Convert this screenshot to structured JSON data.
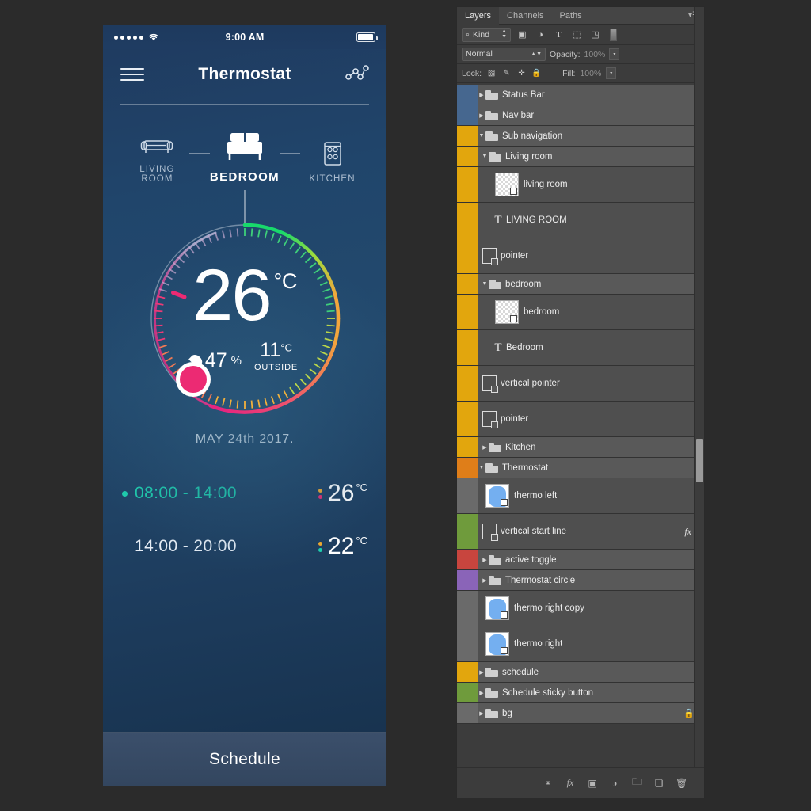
{
  "phone": {
    "status_bar": {
      "signal_dots": 5,
      "wifi_icon": "wifi-icon",
      "time": "9:00 AM",
      "battery_icon": "battery-icon"
    },
    "nav": {
      "menu_icon": "hamburger-icon",
      "title": "Thermostat",
      "graph_icon": "graph-nodes-icon"
    },
    "rooms": [
      {
        "label": "LIVING ROOM",
        "icon": "sofa-icon",
        "active": false
      },
      {
        "label": "BEDROOM",
        "icon": "bed-icon",
        "active": true
      },
      {
        "label": "KITCHEN",
        "icon": "stove-icon",
        "active": false
      }
    ],
    "dial": {
      "temperature": "26",
      "unit": "°C",
      "humidity_value": "47",
      "humidity_unit": "%",
      "humidity_icon": "water-drop-icon",
      "outside_value": "11",
      "outside_unit": "°C",
      "outside_label": "OUTSIDE",
      "handle_color": "#ec2a73",
      "arc_start_color": "#18d96b",
      "arc_mid_color": "#f2b63c",
      "arc_end_color": "#e6257f"
    },
    "date": "MAY 24th 2017.",
    "schedule": [
      {
        "time": "08:00 - 14:00",
        "temp": "26",
        "unit": "°C",
        "active": true,
        "bullet_color": "#1ecfae",
        "time_color": "#1ecfae"
      },
      {
        "time": "14:00 - 20:00",
        "temp": "22",
        "unit": "°C",
        "active": false,
        "bullet_color": "#f0a92e",
        "time_color": "#e7eef6"
      }
    ],
    "schedule_button": "Schedule"
  },
  "photoshop": {
    "tabs": [
      {
        "label": "Layers",
        "active": true
      },
      {
        "label": "Channels",
        "active": false
      },
      {
        "label": "Paths",
        "active": false
      }
    ],
    "panel_menu_icon": "panel-menu-icon",
    "filter": {
      "kind_label": "Kind",
      "search_icon": "search-icon",
      "icons": [
        "pixel-filter-icon",
        "adjustment-filter-icon",
        "type-filter-icon",
        "shape-filter-icon",
        "smartobject-filter-icon"
      ]
    },
    "blend": {
      "mode": "Normal",
      "opacity_label": "Opacity:",
      "opacity_value": "100%"
    },
    "lock": {
      "label": "Lock:",
      "fill_label": "Fill:",
      "fill_value": "100%",
      "icons": [
        "lock-transparent-icon",
        "lock-image-icon",
        "lock-position-icon",
        "lock-all-icon"
      ]
    },
    "layers": [
      {
        "name": "Status Bar",
        "type": "group",
        "color": "#46678f",
        "expanded": false,
        "indent": 0,
        "tall": false
      },
      {
        "name": "Nav bar",
        "type": "group",
        "color": "#46678f",
        "expanded": false,
        "indent": 0,
        "tall": false
      },
      {
        "name": "Sub navigation",
        "type": "group",
        "color": "#e2a60d",
        "expanded": true,
        "indent": 0,
        "tall": false
      },
      {
        "name": "Living room",
        "type": "group",
        "color": "#e2a60d",
        "expanded": true,
        "indent": 1,
        "tall": false
      },
      {
        "name": "living room",
        "type": "raster",
        "color": "#e2a60d",
        "expanded": null,
        "indent": 2,
        "tall": true
      },
      {
        "name": "LIVING ROOM",
        "type": "text",
        "color": "#e2a60d",
        "expanded": null,
        "indent": 2,
        "tall": true
      },
      {
        "name": "pointer",
        "type": "vector",
        "color": "#e2a60d",
        "expanded": null,
        "indent": 1,
        "tall": true
      },
      {
        "name": "bedroom",
        "type": "group",
        "color": "#e2a60d",
        "expanded": true,
        "indent": 1,
        "tall": false
      },
      {
        "name": "bedroom",
        "type": "raster",
        "color": "#e2a60d",
        "expanded": null,
        "indent": 2,
        "tall": true
      },
      {
        "name": "Bedroom",
        "type": "text",
        "color": "#e2a60d",
        "expanded": null,
        "indent": 2,
        "tall": true
      },
      {
        "name": "vertical pointer",
        "type": "vector",
        "color": "#e2a60d",
        "expanded": null,
        "indent": 1,
        "tall": true
      },
      {
        "name": "pointer",
        "type": "vector",
        "color": "#e2a60d",
        "expanded": null,
        "indent": 1,
        "tall": true
      },
      {
        "name": "Kitchen",
        "type": "group",
        "color": "#e2a60d",
        "expanded": false,
        "indent": 1,
        "tall": false
      },
      {
        "name": "Thermostat",
        "type": "group",
        "color": "#df7e19",
        "expanded": true,
        "indent": 0,
        "tall": false
      },
      {
        "name": "thermo left",
        "type": "smart",
        "color": "",
        "expanded": null,
        "indent": 1,
        "tall": true
      },
      {
        "name": "vertical start line",
        "type": "vector",
        "color": "#6f9b3c",
        "expanded": null,
        "indent": 1,
        "tall": true,
        "fx": true
      },
      {
        "name": "active toggle",
        "type": "group",
        "color": "#c8453e",
        "expanded": false,
        "indent": 1,
        "tall": false
      },
      {
        "name": "Thermostat circle",
        "type": "group",
        "color": "#8a64b8",
        "expanded": false,
        "indent": 1,
        "tall": false
      },
      {
        "name": "thermo right copy",
        "type": "smart",
        "color": "",
        "expanded": null,
        "indent": 1,
        "tall": true
      },
      {
        "name": "thermo right",
        "type": "smart",
        "color": "",
        "expanded": null,
        "indent": 1,
        "tall": true
      },
      {
        "name": "schedule",
        "type": "group",
        "color": "#e2a60d",
        "expanded": false,
        "indent": 0,
        "tall": false
      },
      {
        "name": "Schedule sticky button",
        "type": "group",
        "color": "#6f9b3c",
        "expanded": false,
        "indent": 0,
        "tall": false
      },
      {
        "name": "bg",
        "type": "group",
        "color": "",
        "expanded": false,
        "indent": 0,
        "tall": false,
        "locked": true
      }
    ],
    "footer_icons": [
      "link-icon",
      "fx-icon",
      "mask-icon",
      "adjustment-icon",
      "new-group-icon",
      "new-layer-icon",
      "delete-icon"
    ]
  }
}
